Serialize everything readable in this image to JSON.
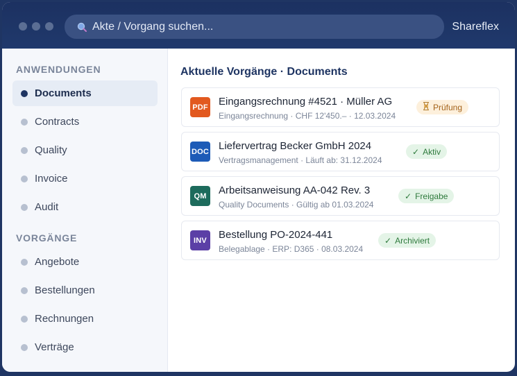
{
  "search": {
    "placeholder": "Akte / Vorgang suchen..."
  },
  "brand": "Shareflex",
  "sidebar": {
    "sections": [
      {
        "label": "ANWENDUNGEN",
        "items": [
          "Documents",
          "Contracts",
          "Quality",
          "Invoice",
          "Audit"
        ]
      },
      {
        "label": "VORGÄNGE",
        "items": [
          "Angebote",
          "Bestellungen",
          "Rechnungen",
          "Verträge"
        ]
      }
    ],
    "active_item": "Documents"
  },
  "main": {
    "title": "Aktuelle Vorgänge · Documents",
    "cards": [
      {
        "icon_label": "PDF",
        "icon_color": "#e2591f",
        "title": "Eingangsrechnung #4521 · Müller AG",
        "subtitle": "Eingangsrechnung · CHF 12'450.– · 12.03.2024",
        "badge_icon": "hourglass-icon",
        "badge_label": "Prüfung",
        "badge_bg": "#fdf0dc",
        "badge_color": "#a4631b"
      },
      {
        "icon_label": "DOC",
        "icon_color": "#1d5bb7",
        "title": "Liefervertrag Becker GmbH 2024",
        "subtitle": "Vertragsmanagement · Läuft ab: 31.12.2024",
        "badge_icon": "checkmark-icon",
        "badge_label": "Aktiv",
        "badge_bg": "#e4f4e7",
        "badge_color": "#2e7a3c"
      },
      {
        "icon_label": "QM",
        "icon_color": "#1d6b5c",
        "title": "Arbeitsanweisung AA-042 Rev. 3",
        "subtitle": "Quality Documents · Gültig ab 01.03.2024",
        "badge_icon": "checkmark-icon",
        "badge_label": "Freigabe",
        "badge_bg": "#e4f4e7",
        "badge_color": "#2e7a3c"
      },
      {
        "icon_label": "INV",
        "icon_color": "#5b3fa6",
        "title": "Bestellung PO-2024-441",
        "subtitle": "Belegablage · ERP: D365 · 08.03.2024",
        "badge_icon": "checkmark-icon",
        "badge_label": "Archiviert",
        "badge_bg": "#e4f4e7",
        "badge_color": "#2e7a3c"
      }
    ]
  }
}
